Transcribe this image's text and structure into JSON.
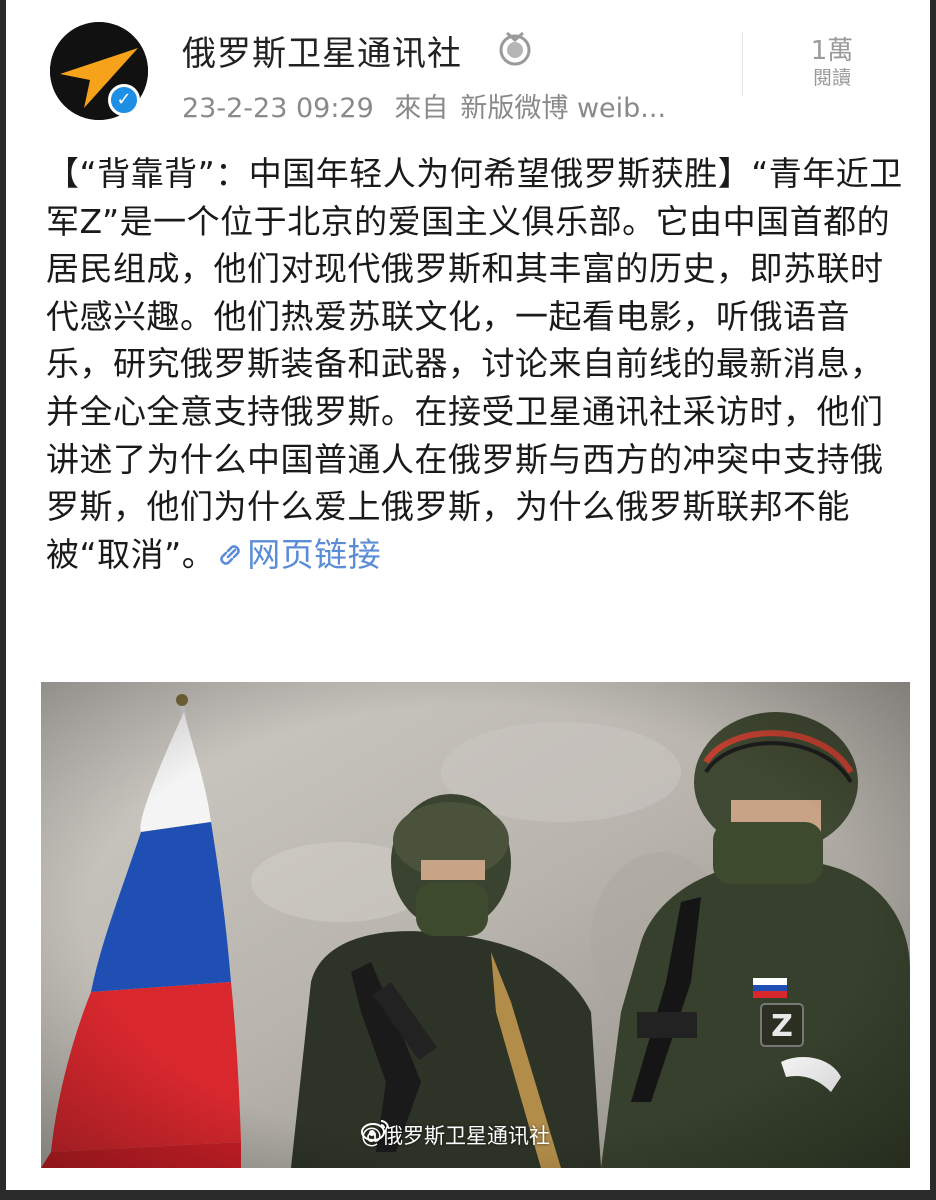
{
  "post": {
    "username": "俄罗斯卫星通讯社",
    "timestamp": "23-2-23 09:29",
    "source_prefix": "來自",
    "source": "新版微博 weib...",
    "views_count": "1萬",
    "views_label": "閱讀",
    "text": "【“背靠背”：中国年轻人为何希望俄罗斯获胜】“青年近卫军Z”是一个位于北京的爱国主义俱乐部。它由中国首都的居民组成，他们对现代俄罗斯和其丰富的历史，即苏联时代感兴趣。他们热爱苏联文化，一起看电影，听俄语音乐，研究俄罗斯装备和武器，讨论来自前线的最新消息，并全心全意支持俄罗斯。在接受卫星通讯社采访时，他们讲述了为什么中国普通人在俄罗斯与西方的冲突中支持俄罗斯，他们为什么爱上俄罗斯，为什么俄罗斯联邦不能被“取消”。",
    "link_label": "网页链接",
    "image_watermark": "@俄罗斯卫星通讯社",
    "patch_letter": "Z"
  },
  "icons": {
    "avatar": "sputnik-logo",
    "verified": "verified-badge-icon",
    "medal": "medal-icon",
    "link": "link-icon",
    "watermark": "weibo-icon"
  },
  "colors": {
    "link": "#5b8cd6",
    "verified": "#1f8fe5",
    "logo_orange": "#f7a21b",
    "meta_gray": "#8a8a8a"
  }
}
